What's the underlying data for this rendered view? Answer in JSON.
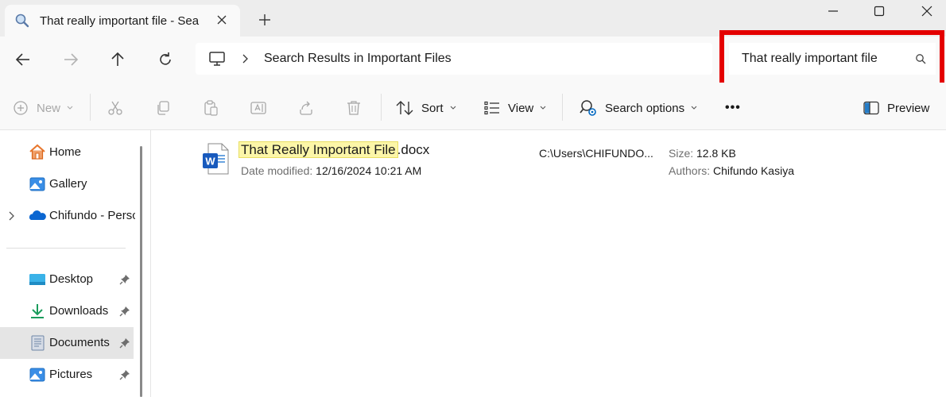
{
  "tab": {
    "title": "That really important file - Sea",
    "icon": "search-icon"
  },
  "address": {
    "location_icon": "this-pc-icon",
    "breadcrumb": "Search Results in Important Files"
  },
  "search": {
    "value": "That really important file",
    "highlight_color": "#e40000"
  },
  "toolbar": {
    "new_label": "New",
    "sort_label": "Sort",
    "view_label": "View",
    "search_options_label": "Search options",
    "more_label": "•••",
    "preview_label": "Preview"
  },
  "sidebar": {
    "items": [
      {
        "label": "Home",
        "icon": "home-icon"
      },
      {
        "label": "Gallery",
        "icon": "gallery-icon"
      },
      {
        "label": "Chifundo - Persc",
        "icon": "onedrive-icon"
      },
      {
        "label": "Desktop",
        "icon": "desktop-icon",
        "pinned": true
      },
      {
        "label": "Downloads",
        "icon": "downloads-icon",
        "pinned": true
      },
      {
        "label": "Documents",
        "icon": "documents-icon",
        "pinned": true,
        "selected": true
      },
      {
        "label": "Pictures",
        "icon": "pictures-icon",
        "pinned": true
      }
    ]
  },
  "results": [
    {
      "name_match": "That Really Important File",
      "name_rest": ".docx",
      "icon": "word-document-icon",
      "date_label": "Date modified:",
      "date_value": "12/16/2024 10:21 AM",
      "path": "C:\\Users\\CHIFUNDO...",
      "size_label": "Size:",
      "size_value": "12.8 KB",
      "authors_label": "Authors:",
      "authors_value": "Chifundo Kasiya"
    }
  ],
  "colors": {
    "accent": "#0067c0",
    "highlight": "#fcf6a8",
    "search_box_outline": "#e40000"
  }
}
